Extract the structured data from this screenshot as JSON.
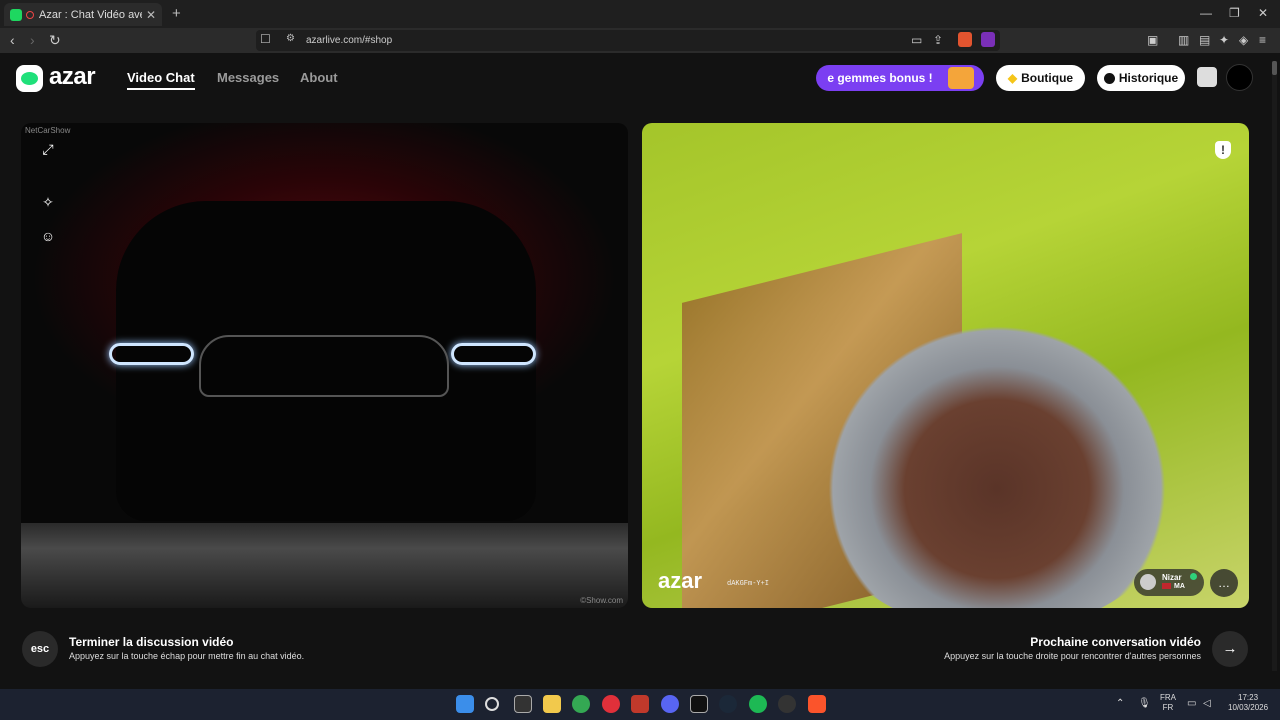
{
  "browser": {
    "tab_title": "Azar : Chat Vidéo avec de no",
    "tab_close": "✕",
    "new_tab": "+",
    "url": "azarlive.com/#shop",
    "window_controls": [
      "—",
      "❐",
      "✕"
    ]
  },
  "header": {
    "logo_text": "azar",
    "nav": [
      "Video Chat",
      "Messages",
      "About"
    ],
    "gem_promo": "e gemmes bonus !",
    "boutique": "Boutique",
    "historique": "Historique"
  },
  "left_video": {
    "watermark_top": "NetCarShow",
    "watermark_bottom": "©Show.com"
  },
  "right_video": {
    "brand": "azar",
    "session_id": "dAKGFm-Y+I",
    "user_name": "Nizar",
    "user_country": "MA"
  },
  "footer": {
    "esc_label": "esc",
    "end_title": "Terminer la discussion vidéo",
    "end_sub": "Appuyez sur la touche échap pour mettre fin au chat vidéo.",
    "next_title": "Prochaine conversation vidéo",
    "next_sub": "Appuyez sur la touche droite pour rencontrer d'autres personnes",
    "next_arrow": "→"
  },
  "taskbar": {
    "lang": "FRA",
    "lang_sub": "FR",
    "time": "17:23",
    "date": "10/03/2026"
  },
  "colors": {
    "accent_purple": "#7b3ff2",
    "brand_green": "#1fe07a"
  }
}
